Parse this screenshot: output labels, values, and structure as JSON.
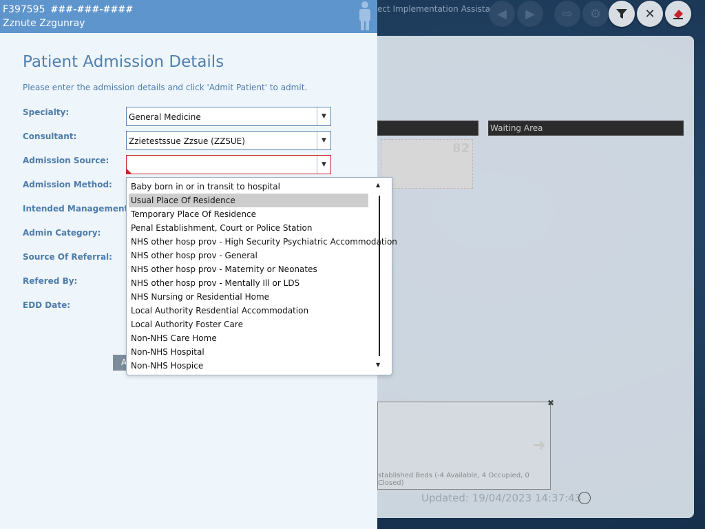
{
  "background": {
    "window_title": "ect Implementation Assistant",
    "toolbar": {
      "buttons": [
        {
          "name": "back",
          "icon": "arrow-left-icon"
        },
        {
          "name": "forward",
          "icon": "arrow-right-icon"
        },
        {
          "name": "export",
          "icon": "export-icon"
        },
        {
          "name": "settings",
          "icon": "gear-icon"
        },
        {
          "name": "filter",
          "icon": "filter-icon"
        },
        {
          "name": "close",
          "icon": "close-icon"
        },
        {
          "name": "eraser",
          "icon": "eraser-icon"
        }
      ]
    },
    "waiting_area_label": "Waiting Area",
    "bed_number": "82",
    "beds_summary": "stablished Beds (-4 Available, 4 Occupied, 0 Closed)",
    "updated_label": "Updated: 19/04/2023 14:37:43"
  },
  "patient": {
    "id": "F397595",
    "nhs_number": "###-###-####",
    "name": "Zznute Zzgunray"
  },
  "form": {
    "title": "Patient Admission Details",
    "instructions": "Please enter the admission details and click 'Admit Patient' to admit.",
    "labels": {
      "specialty": "Specialty:",
      "consultant": "Consultant:",
      "admission_source": "Admission Source:",
      "admission_method": "Admission Method:",
      "intended_management": "Intended Management:",
      "admin_category": "Admin Category:",
      "source_of_referral": "Source Of Referral:",
      "refered_by": "Refered By:",
      "edd_date": "EDD Date:"
    },
    "values": {
      "specialty": "General Medicine",
      "consultant": "Zzietestssue Zzsue (ZZSUE)",
      "admission_source": ""
    },
    "admit_button_label": "A"
  },
  "dropdown": {
    "selected_index": 1,
    "options": [
      "Baby born in or in transit to hospital",
      "Usual Place Of Residence",
      "Temporary Place Of Residence",
      "Penal Establishment, Court or Police Station",
      "NHS other hosp prov - High Security Psychiatric Accommodation",
      "NHS other hosp prov - General",
      "NHS other hosp prov - Maternity or Neonates",
      "NHS other hosp prov - Mentally Ill or LDS",
      "NHS Nursing or Residential Home",
      "Local Authority Resdential Accommodation",
      "Local Authority Foster Care",
      "Non-NHS Care Home",
      "Non-NHS Hospital",
      "Non-NHS Hospice"
    ]
  },
  "colors": {
    "header": "#5f95cd",
    "title": "#4f7faf",
    "error": "#c8232b",
    "selected_item": "#cdcdcd"
  }
}
